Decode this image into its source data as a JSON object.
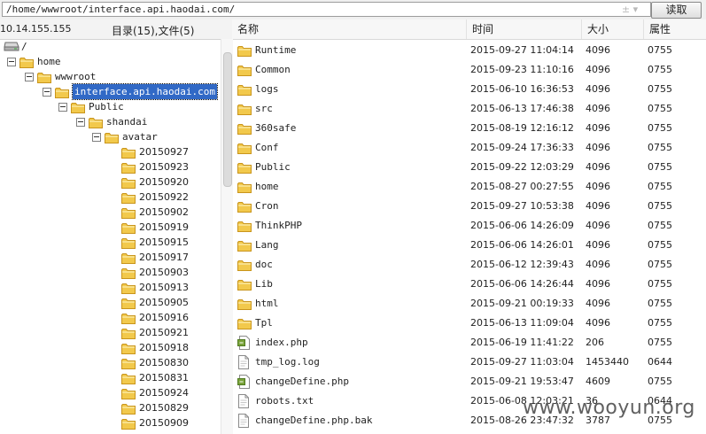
{
  "toolbar": {
    "path": "/home/wwwroot/interface.api.haodai.com/",
    "path_arrows": "± ▾",
    "read_label": "读取"
  },
  "left_panel": {
    "server_ip": "10.14.155.155",
    "summary": "目录(15),文件(5)"
  },
  "tree": [
    {
      "label": "/",
      "level": 0,
      "kind": "drive"
    },
    {
      "label": "home",
      "level": 1,
      "kind": "folder",
      "expanded": true
    },
    {
      "label": "wwwroot",
      "level": 2,
      "kind": "folder",
      "expanded": true
    },
    {
      "label": "interface.api.haodai.com",
      "level": 3,
      "kind": "folder",
      "expanded": true,
      "selected": true
    },
    {
      "label": "Public",
      "level": 4,
      "kind": "folder",
      "expanded": true
    },
    {
      "label": "shandai",
      "level": 5,
      "kind": "folder",
      "expanded": true
    },
    {
      "label": "avatar",
      "level": 6,
      "kind": "folder",
      "expanded": true
    },
    {
      "label": "20150927",
      "level": 7,
      "kind": "folder"
    },
    {
      "label": "20150923",
      "level": 7,
      "kind": "folder"
    },
    {
      "label": "20150920",
      "level": 7,
      "kind": "folder"
    },
    {
      "label": "20150922",
      "level": 7,
      "kind": "folder"
    },
    {
      "label": "20150902",
      "level": 7,
      "kind": "folder"
    },
    {
      "label": "20150919",
      "level": 7,
      "kind": "folder"
    },
    {
      "label": "20150915",
      "level": 7,
      "kind": "folder"
    },
    {
      "label": "20150917",
      "level": 7,
      "kind": "folder"
    },
    {
      "label": "20150903",
      "level": 7,
      "kind": "folder"
    },
    {
      "label": "20150913",
      "level": 7,
      "kind": "folder"
    },
    {
      "label": "20150905",
      "level": 7,
      "kind": "folder"
    },
    {
      "label": "20150916",
      "level": 7,
      "kind": "folder"
    },
    {
      "label": "20150921",
      "level": 7,
      "kind": "folder"
    },
    {
      "label": "20150918",
      "level": 7,
      "kind": "folder"
    },
    {
      "label": "20150830",
      "level": 7,
      "kind": "folder"
    },
    {
      "label": "20150831",
      "level": 7,
      "kind": "folder"
    },
    {
      "label": "20150924",
      "level": 7,
      "kind": "folder"
    },
    {
      "label": "20150829",
      "level": 7,
      "kind": "folder"
    },
    {
      "label": "20150909",
      "level": 7,
      "kind": "folder"
    }
  ],
  "columns": {
    "name": "名称",
    "time": "时间",
    "size": "大小",
    "perm": "属性"
  },
  "files": [
    {
      "name": "Runtime",
      "time": "2015-09-27 11:04:14",
      "size": "4096",
      "perm": "0755",
      "type": "folder"
    },
    {
      "name": "Common",
      "time": "2015-09-23 11:10:16",
      "size": "4096",
      "perm": "0755",
      "type": "folder"
    },
    {
      "name": "logs",
      "time": "2015-06-10 16:36:53",
      "size": "4096",
      "perm": "0755",
      "type": "folder"
    },
    {
      "name": "src",
      "time": "2015-06-13 17:46:38",
      "size": "4096",
      "perm": "0755",
      "type": "folder"
    },
    {
      "name": "360safe",
      "time": "2015-08-19 12:16:12",
      "size": "4096",
      "perm": "0755",
      "type": "folder"
    },
    {
      "name": "Conf",
      "time": "2015-09-24 17:36:33",
      "size": "4096",
      "perm": "0755",
      "type": "folder"
    },
    {
      "name": "Public",
      "time": "2015-09-22 12:03:29",
      "size": "4096",
      "perm": "0755",
      "type": "folder"
    },
    {
      "name": "home",
      "time": "2015-08-27 00:27:55",
      "size": "4096",
      "perm": "0755",
      "type": "folder"
    },
    {
      "name": "Cron",
      "time": "2015-09-27 10:53:38",
      "size": "4096",
      "perm": "0755",
      "type": "folder"
    },
    {
      "name": "ThinkPHP",
      "time": "2015-06-06 14:26:09",
      "size": "4096",
      "perm": "0755",
      "type": "folder"
    },
    {
      "name": "Lang",
      "time": "2015-06-06 14:26:01",
      "size": "4096",
      "perm": "0755",
      "type": "folder"
    },
    {
      "name": "doc",
      "time": "2015-06-12 12:39:43",
      "size": "4096",
      "perm": "0755",
      "type": "folder"
    },
    {
      "name": "Lib",
      "time": "2015-06-06 14:26:44",
      "size": "4096",
      "perm": "0755",
      "type": "folder"
    },
    {
      "name": "html",
      "time": "2015-09-21 00:19:33",
      "size": "4096",
      "perm": "0755",
      "type": "folder"
    },
    {
      "name": "Tpl",
      "time": "2015-06-13 11:09:04",
      "size": "4096",
      "perm": "0755",
      "type": "folder"
    },
    {
      "name": "index.php",
      "time": "2015-06-19 11:41:22",
      "size": "206",
      "perm": "0755",
      "type": "php"
    },
    {
      "name": "tmp_log.log",
      "time": "2015-09-27 11:03:04",
      "size": "1453440",
      "perm": "0644",
      "type": "file"
    },
    {
      "name": "changeDefine.php",
      "time": "2015-09-21 19:53:47",
      "size": "4609",
      "perm": "0755",
      "type": "php"
    },
    {
      "name": "robots.txt",
      "time": "2015-06-08 12:03:21",
      "size": "36",
      "perm": "0644",
      "type": "file"
    },
    {
      "name": "changeDefine.php.bak",
      "time": "2015-08-26 23:47:32",
      "size": "3787",
      "perm": "0755",
      "type": "file"
    }
  ],
  "watermark": "www.wooyun.org",
  "colors": {
    "folder": "#f2c94c",
    "folder_dark": "#c9951c",
    "selection": "#3169c6"
  }
}
